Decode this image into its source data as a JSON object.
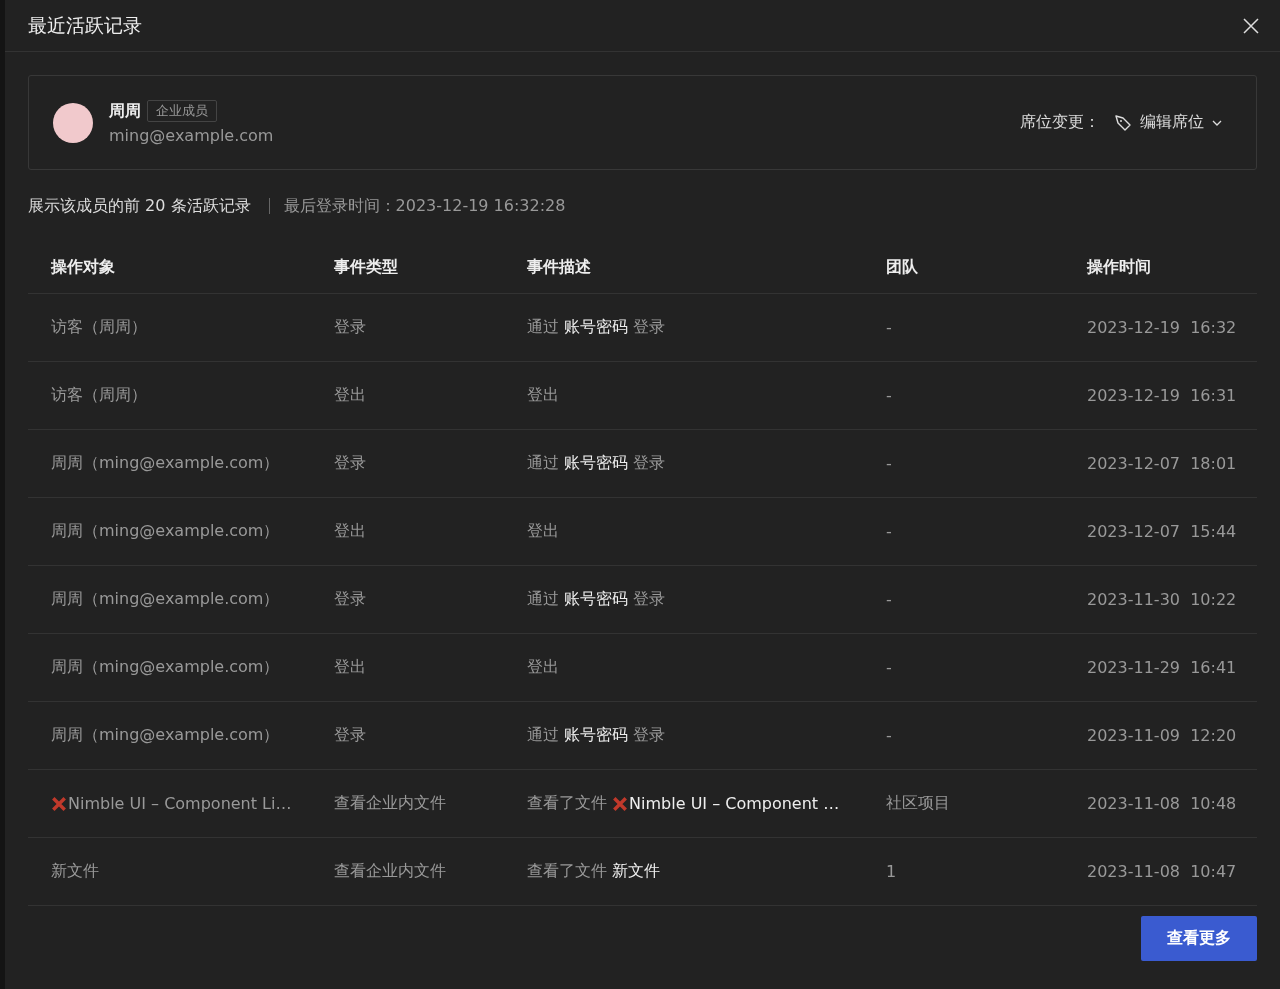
{
  "window": {
    "title": "最近活跃记录"
  },
  "member": {
    "name": "周周",
    "role": "企业成员",
    "email": "ming@example.com",
    "seat_label": "席位变更：",
    "seat_action": "编辑席位"
  },
  "summary": {
    "text": "展示该成员的前 20 条活跃记录",
    "last_login": "最后登录时间：2023-12-19 16:32:28"
  },
  "table": {
    "columns": [
      "操作对象",
      "事件类型",
      "事件描述",
      "团队",
      "操作时间"
    ],
    "rows": [
      {
        "target": "访客（周周）",
        "deleted": false,
        "type": "登录",
        "desc": "通过 **账号密码** 登录",
        "team": "-",
        "time": "2023-12-19  16:32"
      },
      {
        "target": "访客（周周）",
        "deleted": false,
        "type": "登出",
        "desc": "登出",
        "team": "-",
        "time": "2023-12-19  16:31"
      },
      {
        "target": "周周（ming@example.com）",
        "deleted": false,
        "type": "登录",
        "desc": "通过 **账号密码** 登录",
        "team": "-",
        "time": "2023-12-07  18:01"
      },
      {
        "target": "周周（ming@example.com）",
        "deleted": false,
        "type": "登出",
        "desc": "登出",
        "team": "-",
        "time": "2023-12-07  15:44"
      },
      {
        "target": "周周（ming@example.com）",
        "deleted": false,
        "type": "登录",
        "desc": "通过 **账号密码** 登录",
        "team": "-",
        "time": "2023-11-30  10:22"
      },
      {
        "target": "周周（ming@example.com）",
        "deleted": false,
        "type": "登出",
        "desc": "登出",
        "team": "-",
        "time": "2023-11-29  16:41"
      },
      {
        "target": "周周（ming@example.com）",
        "deleted": false,
        "type": "登录",
        "desc": "通过 **账号密码** 登录",
        "team": "-",
        "time": "2023-11-09  12:20"
      },
      {
        "target": "Nimble UI – Component Li…",
        "deleted": true,
        "type": "查看企业内文件",
        "desc_prefix": "查看了文件 ",
        "desc_file": "Nimble UI – Component …",
        "team": "社区项目",
        "time": "2023-11-08  10:48"
      },
      {
        "target": "新文件",
        "deleted": false,
        "type": "查看企业内文件",
        "desc_prefix": "查看了文件 ",
        "desc_file": "新文件",
        "team": "1",
        "time": "2023-11-08  10:47"
      }
    ]
  },
  "more_button": "查看更多"
}
